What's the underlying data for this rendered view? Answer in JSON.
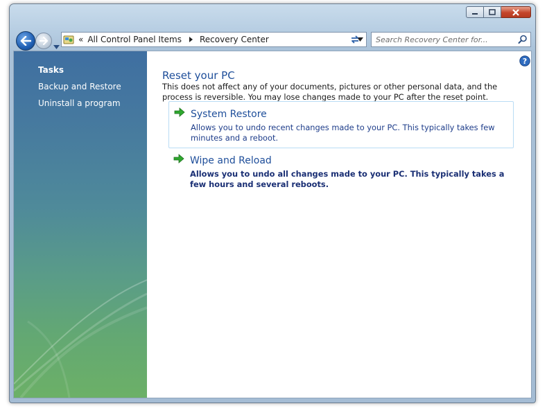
{
  "address": {
    "crumbs": [
      "All Control Panel Items",
      "Recovery Center"
    ],
    "prefix": "«"
  },
  "search": {
    "placeholder": "Search Recovery Center for..."
  },
  "sidebar": {
    "title": "Tasks",
    "links": [
      "Backup and Restore",
      "Uninstall a program"
    ]
  },
  "main": {
    "title": "Reset your PC",
    "description": "This does not affect any of your documents, pictures or other personal data, and the process is reversible. You may lose changes made to your PC after the reset point.",
    "options": [
      {
        "title": "System Restore",
        "description": "Allows you to undo recent changes made to your PC. This typically takes few minutes and a reboot."
      },
      {
        "title": "Wipe and Reload",
        "description": "Allows you to undo all changes made to your PC. This typically takes a few hours and several reboots."
      }
    ]
  },
  "colors": {
    "accent": "#1e4e9a",
    "sidebar_top": "#3f6fa1",
    "sidebar_bottom": "#6cb067",
    "close_button": "#c4452a"
  },
  "icons": {
    "back": "back-arrow-icon",
    "forward": "forward-arrow-icon",
    "control_panel": "control-panel-icon",
    "refresh": "refresh-icon",
    "search": "search-icon",
    "help": "help-icon",
    "option_arrow": "green-arrow-icon"
  }
}
